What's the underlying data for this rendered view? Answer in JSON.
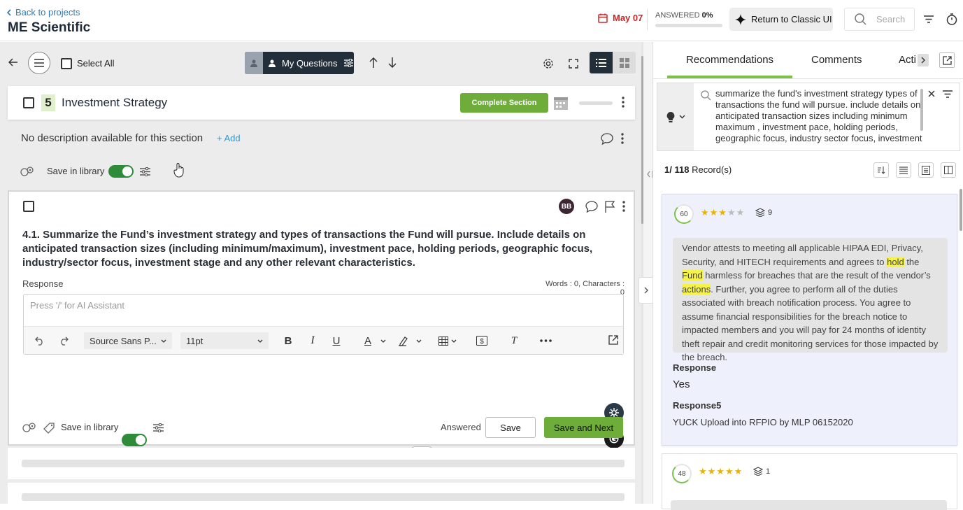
{
  "header": {
    "back_label": "Back to projects",
    "project_title": "ME Scientific",
    "due_date": "May 07",
    "answered_label": "ANSWERED",
    "answered_pct": "0%",
    "answered_fraction": 0,
    "classic_ui_label": "Return to Classic UI",
    "search_placeholder": "Search"
  },
  "toolbar": {
    "select_all_label": "Select All",
    "my_questions_label": "My Questions"
  },
  "section": {
    "number": "5",
    "title": "Investment Strategy",
    "complete_label": "Complete Section",
    "description": "No description available for this section",
    "add_label": "Add",
    "save_in_library_label": "Save in library"
  },
  "question": {
    "assignee_initials": "BB",
    "text": "4.1. Summarize the Fund’s investment strategy and types of transactions the Fund will pursue. Include details on anticipated transaction sizes (including minimum/maximum), investment pace, holding periods, geographic focus, industry/sector focus, investment stage and any other relevant characteristics.",
    "response_label": "Response",
    "word_count": "Words : 0, Characters : 0",
    "placeholder": "Press '/' for AI Assistant",
    "font_family": "Source Sans P...",
    "font_size": "11pt",
    "save_in_library_label": "Save in library",
    "answered_label": "Answered",
    "save_label": "Save",
    "save_next_label": "Save and Next"
  },
  "right_panel": {
    "tabs": [
      "Recommendations",
      "Comments",
      "Acti"
    ],
    "query": "summarize the fund's investment strategy types of transactions the fund will pursue. include details on anticipated transaction sizes including minimum maximum , investment pace, holding periods, geographic focus, industry sector focus, investment stage and any other",
    "records_current": "1/",
    "records_total": "118",
    "records_label": "Record(s)",
    "results": [
      {
        "score": "60",
        "stars": 3,
        "versions": "9",
        "text_parts": [
          {
            "t": "Vendor attests to meeting all applicable HIPAA EDI, Privacy, Security, and HITECH requirements and agrees to ",
            "h": false
          },
          {
            "t": "hold",
            "h": true
          },
          {
            "t": " the ",
            "h": false
          },
          {
            "t": "Fund",
            "h": true
          },
          {
            "t": " harmless for breaches that are the result of the vendor’s ",
            "h": false
          },
          {
            "t": "actions",
            "h": true
          },
          {
            "t": ". Further, you agree to perform all of the duties associated with breach notification process. You agree to assume financial responsibilities for the breach notice to impacted members and you will pay for 24 months of identity theft repair and credit monitoring services for those impacted by the breach.",
            "h": false
          }
        ],
        "field1_label": "Response",
        "field1_value": "Yes",
        "field2_label": "Response5",
        "field2_value": "YUCK Upload into RFPIO by MLP 06152020"
      },
      {
        "score": "48",
        "stars": 5,
        "versions": "1"
      }
    ]
  },
  "colors": {
    "accent_green": "#6fad3a",
    "toggle_green": "#2e8b3a",
    "link_blue": "#2b7bb9",
    "date_red": "#c62828",
    "dark_navy": "#222e3a",
    "highlight_yellow": "#f5f24a"
  }
}
